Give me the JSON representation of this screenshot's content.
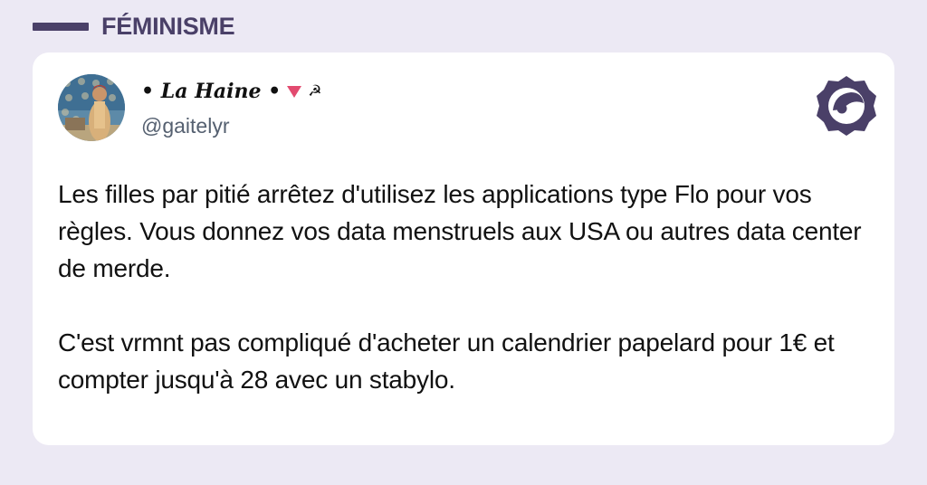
{
  "category": {
    "label": "FÉMINISME"
  },
  "author": {
    "display_name": "• La Haine •",
    "sickle_glyph": "☭",
    "handle": "@gaitelyr"
  },
  "tweet": {
    "paragraph_1": "Les filles par pitié arrêtez d'utilisez les applications type Flo pour vos règles. Vous donnez vos data menstruels aux USA ou autres data center de merde.",
    "paragraph_2": "C'est vrmnt pas compliqué d'acheter un calendrier papelard pour 1€ et compter jusqu'à 28 avec un stabylo."
  },
  "icons": {
    "brand": "brand-logo-icon",
    "triangle": "triangle-flag-icon"
  },
  "colors": {
    "background": "#ece9f4",
    "accent": "#4a4068",
    "card": "#ffffff",
    "text": "#111111",
    "handle": "#556070",
    "triangle": "#e24a6f"
  }
}
